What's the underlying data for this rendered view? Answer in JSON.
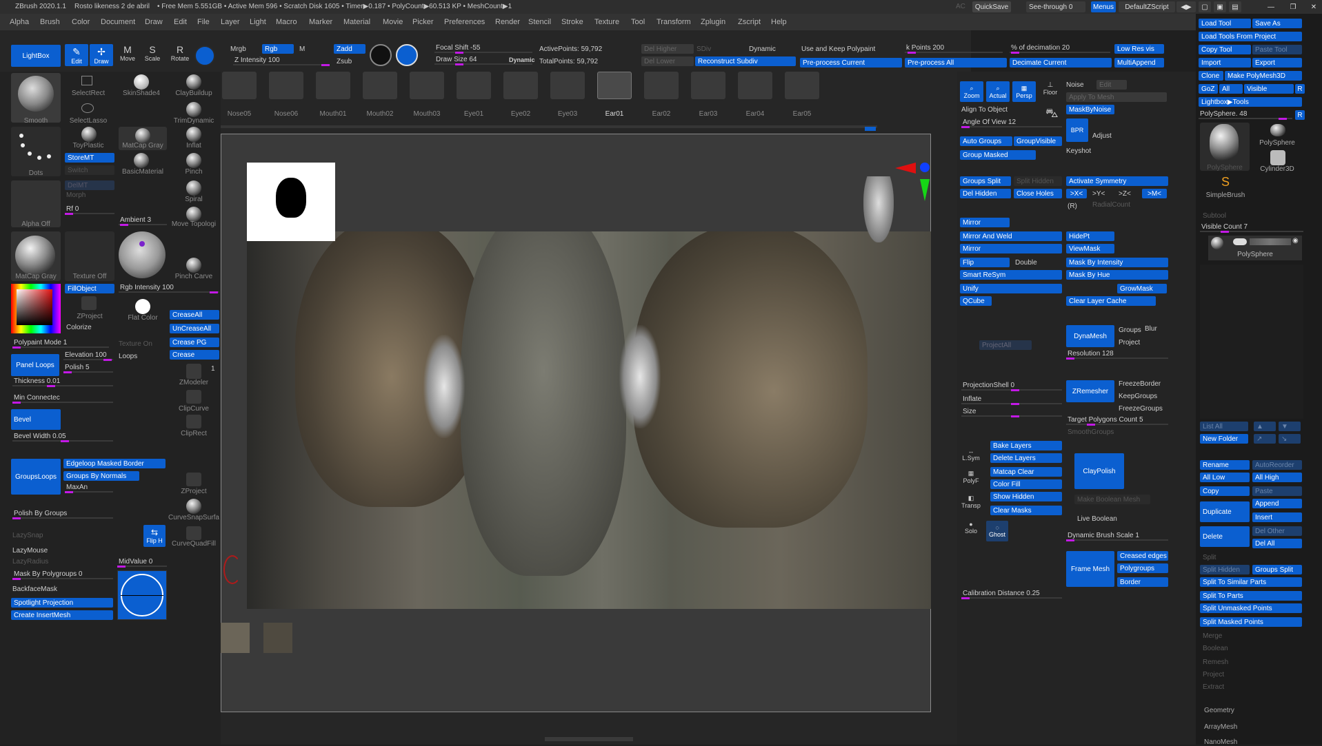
{
  "app": {
    "title": "ZBrush 2020.1.1",
    "doc": "Rosto likeness 2 de abril",
    "stats": "• Free Mem 5.551GB • Active Mem 596 • Scratch Disk 1605 • Timer▶0.187 • PolyCount▶60.513 KP • MeshCount▶1",
    "ac": "AC",
    "quicksave": "QuickSave",
    "seethrough": "See-through 0",
    "menus": "Menus",
    "defaultzscript": "DefaultZScript"
  },
  "menu": [
    "Alpha",
    "Brush",
    "Color",
    "Document",
    "Draw",
    "Edit",
    "File",
    "Layer",
    "Light",
    "Macro",
    "Marker",
    "Material",
    "Movie",
    "Picker",
    "Preferences",
    "Render",
    "Stencil",
    "Stroke",
    "Texture",
    "Tool",
    "Transform",
    "Zplugin",
    "Zscript",
    "Help"
  ],
  "shelf": {
    "lightbox": "LightBox",
    "edit": "Edit",
    "draw": "Draw",
    "move": "Move",
    "scale": "Scale",
    "rotate": "Rotate",
    "mrgb": "Mrgb",
    "rgb": "Rgb",
    "m": "M",
    "zadd": "Zadd",
    "zsub": "Zsub",
    "zintensity": "Z Intensity 100",
    "focal": "Focal Shift -55",
    "drawsize": "Draw Size 64",
    "dynamic": "Dynamic",
    "active": "ActivePoints: 59,792",
    "total": "TotalPoints: 59,792",
    "delhigher": "Del Higher",
    "sdiv": "SDiv",
    "dyn2": "Dynamic",
    "dellower": "Del Lower",
    "reconstruct": "Reconstruct Subdiv",
    "usekeep": "Use and Keep Polypaint",
    "kpoints": "k Points 200",
    "decper": "% of decimation 20",
    "lowres": "Low Res vis",
    "preproccur": "Pre-process Current",
    "preprocall": "Pre-process All",
    "decimate": "Decimate Current",
    "multiappend": "MultiAppend"
  },
  "brushes": [
    "Nose05",
    "Nose06",
    "Mouth01",
    "Mouth02",
    "Mouth03",
    "Eye01",
    "Eye02",
    "Eye03",
    "Ear01",
    "Ear02",
    "Ear03",
    "Ear04",
    "Ear05"
  ],
  "left": {
    "selectrect": "SelectRect",
    "skinshade": "SkinShade4",
    "claybuildup": "ClayBuildup",
    "smooth": "Smooth",
    "selectlasso": "SelectLasso",
    "trimdynamic": "TrimDynamic",
    "toyplastic": "ToyPlastic",
    "matcapgray": "MatCap Gray",
    "inflat": "Inflat",
    "dots": "Dots",
    "storemt": "StoreMT",
    "switch": "Switch",
    "basicmaterial": "BasicMaterial",
    "pinch": "Pinch",
    "delmt": "DelMT",
    "morph": "Morph",
    "spiral": "Spiral",
    "alphaoff": "Alpha Off",
    "rf": "Rf 0",
    "ambient": "Ambient 3",
    "movetopo": "Move Topologi",
    "matcapgray2": "MatCap Gray",
    "textureoff": "Texture Off",
    "pinchcarve": "Pinch Carve",
    "fillobject": "FillObject",
    "rgbint": "Rgb Intensity 100",
    "zproject": "ZProject",
    "flatcolor": "Flat Color",
    "colorize": "Colorize",
    "creaseall": "CreaseAll",
    "uncreaseall": "UnCreaseAll",
    "creasepg": "Crease PG",
    "crease": "Crease",
    "polypaint": "Polypaint Mode 1",
    "textureon": "Texture On",
    "panelloops": "Panel Loops",
    "elevation": "Elevation 100",
    "loops": "Loops",
    "polish": "Polish 5",
    "thickness": "Thickness 0.01",
    "zmodeler": "ZModeler",
    "one": "1",
    "minconn": "Min Connectec",
    "clipcurve": "ClipCurve",
    "bevel": "Bevel",
    "cliprect": "ClipRect",
    "bevelwidth": "Bevel Width 0.05",
    "groupsloops": "GroupsLoops",
    "edgeloop": "Edgeloop Masked Border",
    "groupsbynormals": "Groups By Normals",
    "maxan": "MaxAn",
    "zproject2": "ZProject",
    "curvesnap": "CurveSnapSurfa",
    "polishbygroups": "Polish By Groups",
    "curvequad": "CurveQuadFill",
    "lazysnap": "LazySnap",
    "fliph": "Flip H",
    "lazymouse": "LazyMouse",
    "lazyradius": "LazyRadius",
    "midvalue": "MidValue 0",
    "maskbypoly": "Mask By Polygroups 0",
    "backface": "BackfaceMask",
    "spotlight": "Spotlight Projection",
    "createinsert": "Create InsertMesh"
  },
  "right": {
    "zoom": "Zoom",
    "actual": "Actual",
    "persp": "Persp",
    "floor": "Floor",
    "noise": "Noise",
    "edit": "Edit",
    "applytomesh": "Apply To Mesh",
    "aligntoobj": "Align To Object",
    "maskbynoise": "MaskByNoise",
    "angleofview": "Angle Of View 12",
    "bpr": "BPR",
    "adjust": "Adjust",
    "keyshot": "Keyshot",
    "autogroups": "Auto Groups",
    "groupvisible": "GroupVisible",
    "groupmasked": "Group Masked",
    "groupssplit": "Groups Split",
    "splithidden": "Split Hidden",
    "activatesym": "Activate Symmetry",
    "delhidden": "Del Hidden",
    "closeholes": "Close Holes",
    "xsym": ">X<",
    "ysym": ">Y<",
    "zsym": ">Z<",
    "msym": ">M<",
    "r": "(R)",
    "radialcount": "RadialCount",
    "mirror": "Mirror",
    "mirrorweld": "Mirror And Weld",
    "hidept": "HidePt",
    "mirror2": "Mirror",
    "viewmask": "ViewMask",
    "flip": "Flip",
    "double": "Double",
    "maskbyint": "Mask By Intensity",
    "smartresym": "Smart ReSym",
    "maskbyhue": "Mask By Hue",
    "unify": "Unify",
    "growmask": "GrowMask",
    "qcube": "QCube",
    "clearlayer": "Clear Layer Cache",
    "projectall": "ProjectAll",
    "dynamesh": "DynaMesh",
    "groups": "Groups",
    "blur": "Blur",
    "project": "Project",
    "resolution": "Resolution 128",
    "projshell": "ProjectionShell 0",
    "inflate": "Inflate",
    "size": "Size",
    "zremesher": "ZRemesher",
    "freezeborder": "FreezeBorder",
    "keepgroups": "KeepGroups",
    "freezegroups": "FreezeGroups",
    "targetpoly": "Target Polygons Count 5",
    "smoothgroups": "SmoothGroups",
    "lsym": "L.Sym",
    "polyf": "PolyF",
    "transp": "Transp",
    "solo": "Solo",
    "ghost": "Ghost",
    "bakelayers": "Bake Layers",
    "deletelayers": "Delete Layers",
    "matcapclear": "Matcap Clear",
    "colorfill": "Color Fill",
    "showhidden": "Show Hidden",
    "clearmasks": "Clear Masks",
    "claypolish": "ClayPolish",
    "makeboolean": "Make Boolean Mesh",
    "liveboolean": "Live Boolean",
    "dynbrushscale": "Dynamic Brush Scale 1",
    "framemesh": "Frame Mesh",
    "creasededges": "Creased edges",
    "polygroups": "Polygroups",
    "border": "Border",
    "calibration": "Calibration Distance 0.25"
  },
  "tool": {
    "loadtool": "Load Tool",
    "saveas": "Save As",
    "loadfromproject": "Load Tools From Project",
    "copytool": "Copy Tool",
    "pastetool": "Paste Tool",
    "import": "Import",
    "export": "Export",
    "clone": "Clone",
    "makepoly": "Make PolyMesh3D",
    "goz": "GoZ",
    "all": "All",
    "visible": "Visible",
    "r": "R",
    "lightboxtools": "Lightbox▶Tools",
    "polysphere": "PolySphere. 48",
    "polysphere2": "PolySphere",
    "polysphere3": "PolySphere",
    "cylinder": "Cylinder3D",
    "simplebrush": "SimpleBrush",
    "subtool": "Subtool",
    "visiblecount": "Visible Count 7",
    "subtoolname": "PolySphere",
    "listall": "List All",
    "newfolder": "New Folder",
    "rename": "Rename",
    "autoreorder": "AutoReorder",
    "alllow": "All Low",
    "allhigh": "All High",
    "copy": "Copy",
    "paste": "Paste",
    "append": "Append",
    "duplicate": "Duplicate",
    "insert": "Insert",
    "delete": "Delete",
    "delother": "Del Other",
    "delall": "Del All",
    "split": "Split",
    "splithidden": "Split Hidden",
    "groupssplit": "Groups Split",
    "splitsimilar": "Split To Similar Parts",
    "splitparts": "Split To Parts",
    "splitunmasked": "Split Unmasked Points",
    "splitmasked": "Split Masked Points",
    "merge": "Merge",
    "boolean": "Boolean",
    "remesh": "Remesh",
    "project": "Project",
    "extract": "Extract",
    "geometry": "Geometry",
    "arraymesh": "ArrayMesh",
    "nanomesh": "NanoMesh"
  }
}
